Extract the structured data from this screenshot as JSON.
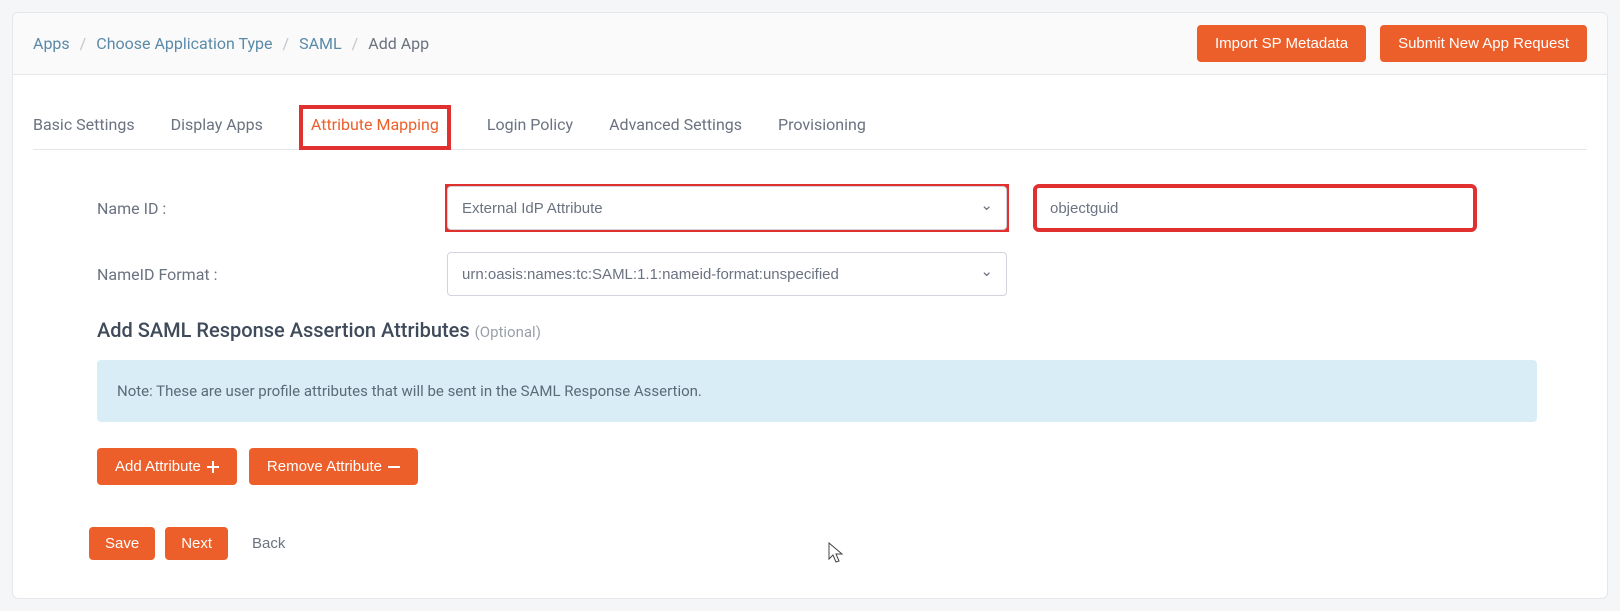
{
  "breadcrumb": {
    "apps": "Apps",
    "choose_type": "Choose Application Type",
    "saml": "SAML",
    "current": "Add App"
  },
  "header_buttons": {
    "import_metadata": "Import SP Metadata",
    "submit_request": "Submit New App Request"
  },
  "tabs": {
    "basic": "Basic Settings",
    "display": "Display Apps",
    "attribute_mapping": "Attribute Mapping",
    "login_policy": "Login Policy",
    "advanced": "Advanced Settings",
    "provisioning": "Provisioning"
  },
  "form": {
    "name_id_label": "Name ID :",
    "name_id_value": "External IdP Attribute",
    "name_id_text_value": "objectguid",
    "nameid_format_label": "NameID Format :",
    "nameid_format_value": "urn:oasis:names:tc:SAML:1.1:nameid-format:unspecified"
  },
  "section": {
    "title": "Add SAML Response Assertion Attributes",
    "optional": "(Optional)",
    "note": "Note: These are user profile attributes that will be sent in the SAML Response Assertion."
  },
  "buttons": {
    "add_attribute": "Add Attribute",
    "remove_attribute": "Remove Attribute",
    "save": "Save",
    "next": "Next",
    "back": "Back"
  }
}
